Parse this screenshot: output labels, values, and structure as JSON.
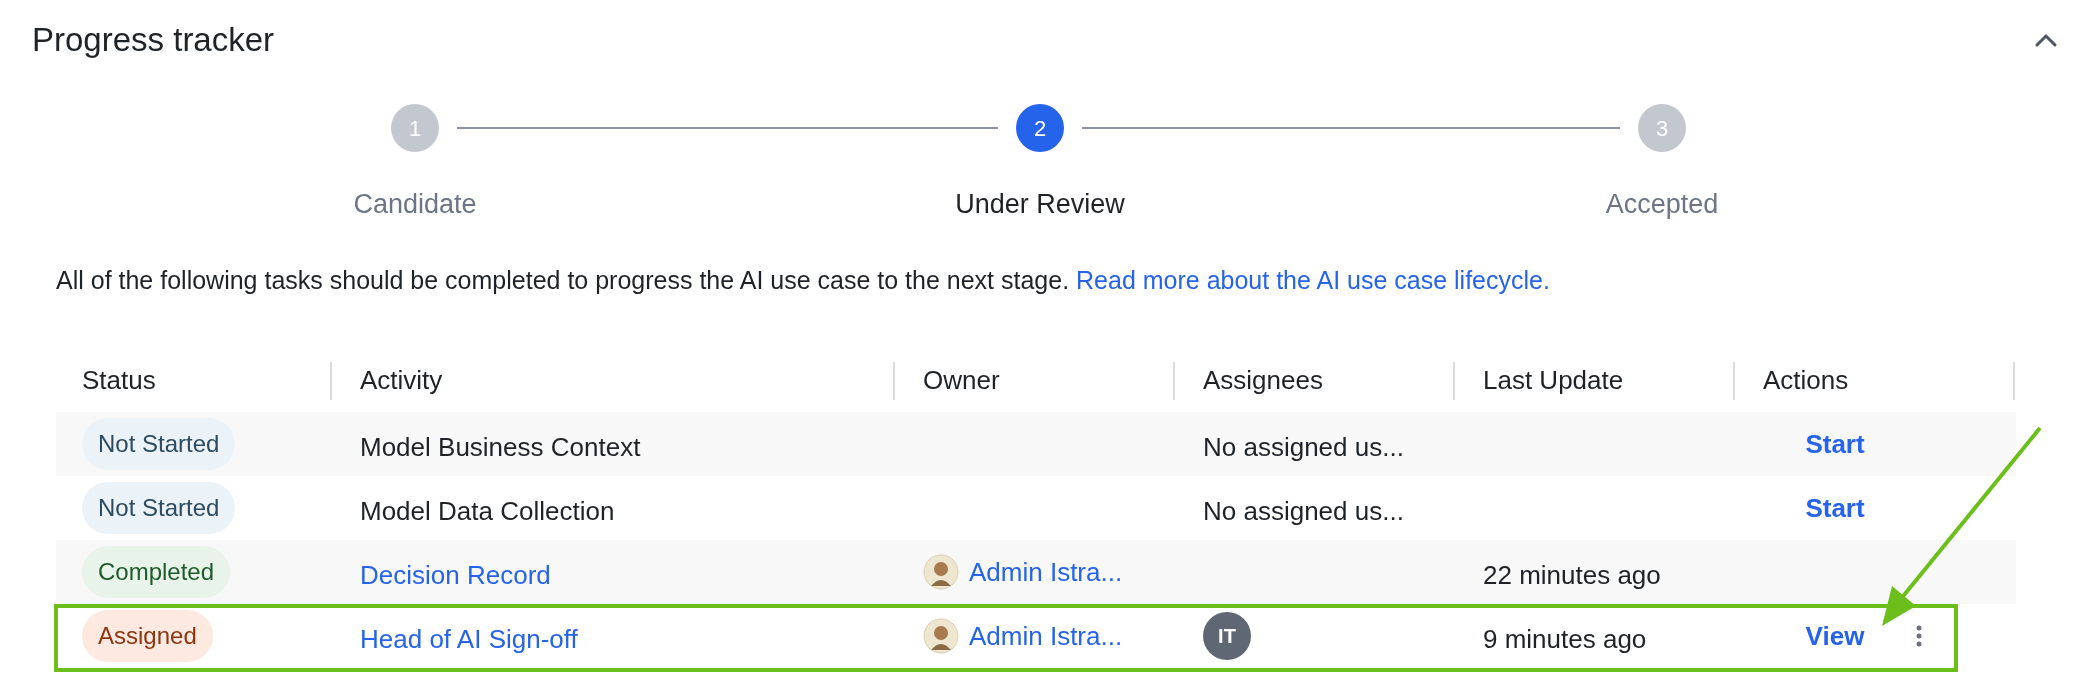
{
  "title": "Progress tracker",
  "collapse_expanded": true,
  "steps": [
    {
      "number": "1",
      "label": "Candidate",
      "selected": false
    },
    {
      "number": "2",
      "label": "Under Review",
      "selected": true
    },
    {
      "number": "3",
      "label": "Accepted",
      "selected": false
    }
  ],
  "description": {
    "text": "All of the following tasks should be completed to progress the AI use case to the next stage.",
    "link": "Read more about the AI use case lifecycle."
  },
  "table": {
    "columns": [
      "Status",
      "Activity",
      "Owner",
      "Assignees",
      "Last Update",
      "Actions"
    ],
    "rows": [
      {
        "status": {
          "label": "Not Started",
          "kind": "not_started"
        },
        "activity": {
          "text": "Model Business Context",
          "kind": "text"
        },
        "assignees": {
          "text": "No assigned us...",
          "kind": "text"
        },
        "action": "Start",
        "more_menu": false,
        "highlighted": false
      },
      {
        "status": {
          "label": "Not Started",
          "kind": "not_started"
        },
        "activity": {
          "text": "Model Data Collection",
          "kind": "text"
        },
        "assignees": {
          "text": "No assigned us...",
          "kind": "text"
        },
        "action": "Start",
        "more_menu": false,
        "highlighted": false
      },
      {
        "status": {
          "label": "Completed",
          "kind": "completed"
        },
        "activity": {
          "text": "Decision Record",
          "kind": "link"
        },
        "owner": "Admin Istra...",
        "last_update": "22 minutes ago",
        "more_menu": false,
        "highlighted": false
      },
      {
        "status": {
          "label": "Assigned",
          "kind": "assigned"
        },
        "activity": {
          "text": "Head of AI Sign-off",
          "kind": "link"
        },
        "owner": "Admin Istra...",
        "assignees": {
          "text": "IT",
          "kind": "initials"
        },
        "last_update": "9 minutes ago",
        "action": "View",
        "more_menu": true,
        "highlighted": true
      }
    ]
  }
}
